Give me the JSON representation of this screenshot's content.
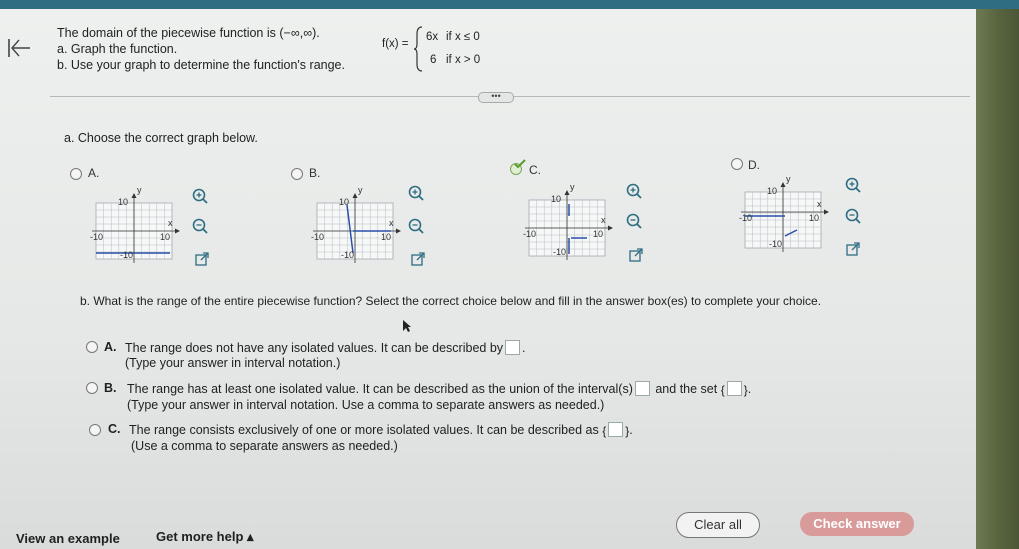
{
  "header": {
    "line1_prefix": "The domain of the piecewise function is",
    "domain_text": "(−∞,∞).",
    "line2": "a. Graph the function.",
    "line3": "b. Use your graph to determine the function's range."
  },
  "function": {
    "lhs": "f(x) =",
    "case1_expr": "6x",
    "case1_cond": "if  x ≤ 0",
    "case2_expr": "6",
    "case2_cond": "if  x > 0"
  },
  "more_button_label": "•••",
  "part_a": {
    "prompt": "a. Choose the correct graph below.",
    "options": [
      {
        "label": "A.",
        "y_label": "y",
        "x_label": "x",
        "ytick": "10",
        "xneg": "-10",
        "xpos": "10",
        "yneg": "-10",
        "selected": false
      },
      {
        "label": "B.",
        "y_label": "y",
        "x_label": "x",
        "ytick": "10",
        "xneg": "-10",
        "xpos": "10",
        "yneg": "-10",
        "selected": false
      },
      {
        "label": "C.",
        "y_label": "y",
        "x_label": "x",
        "ytick": "10",
        "xneg": "-10",
        "xpos": "10",
        "yneg": "-10",
        "selected": true
      },
      {
        "label": "D.",
        "y_label": "y",
        "x_label": "x",
        "ytick": "10",
        "xneg": "-10",
        "xpos": "10",
        "yneg": "-10",
        "selected": false
      }
    ]
  },
  "part_b": {
    "prompt": "b. What is the range of the entire piecewise function? Select the correct choice below and fill in the answer box(es) to complete your choice.",
    "optA_label": "A.",
    "optA_text": "The range does not have any isolated values. It can be described by",
    "optA_note": "(Type your answer in interval notation.)",
    "optB_label": "B.",
    "optB_text1": "The range has at least one isolated value. It can be described as the union of the interval(s)",
    "optB_text2": "and the set",
    "optB_note": "(Type your answer in interval notation. Use a comma to separate answers as needed.)",
    "optC_label": "C.",
    "optC_text": "The range consists exclusively of one or more isolated values. It can be described as",
    "optC_note": "(Use a comma to separate answers as needed.)",
    "open_brace": "{",
    "close_brace": "}"
  },
  "footer": {
    "view_example": "View an example",
    "get_more_help": "Get more help ▴",
    "clear_all": "Clear all",
    "check_answer": "Check answer"
  },
  "colors": {
    "accent": "#2e6d82",
    "check": "#d99a9a",
    "plot": "#2a4fa8",
    "selected": "#5a9a2e"
  }
}
